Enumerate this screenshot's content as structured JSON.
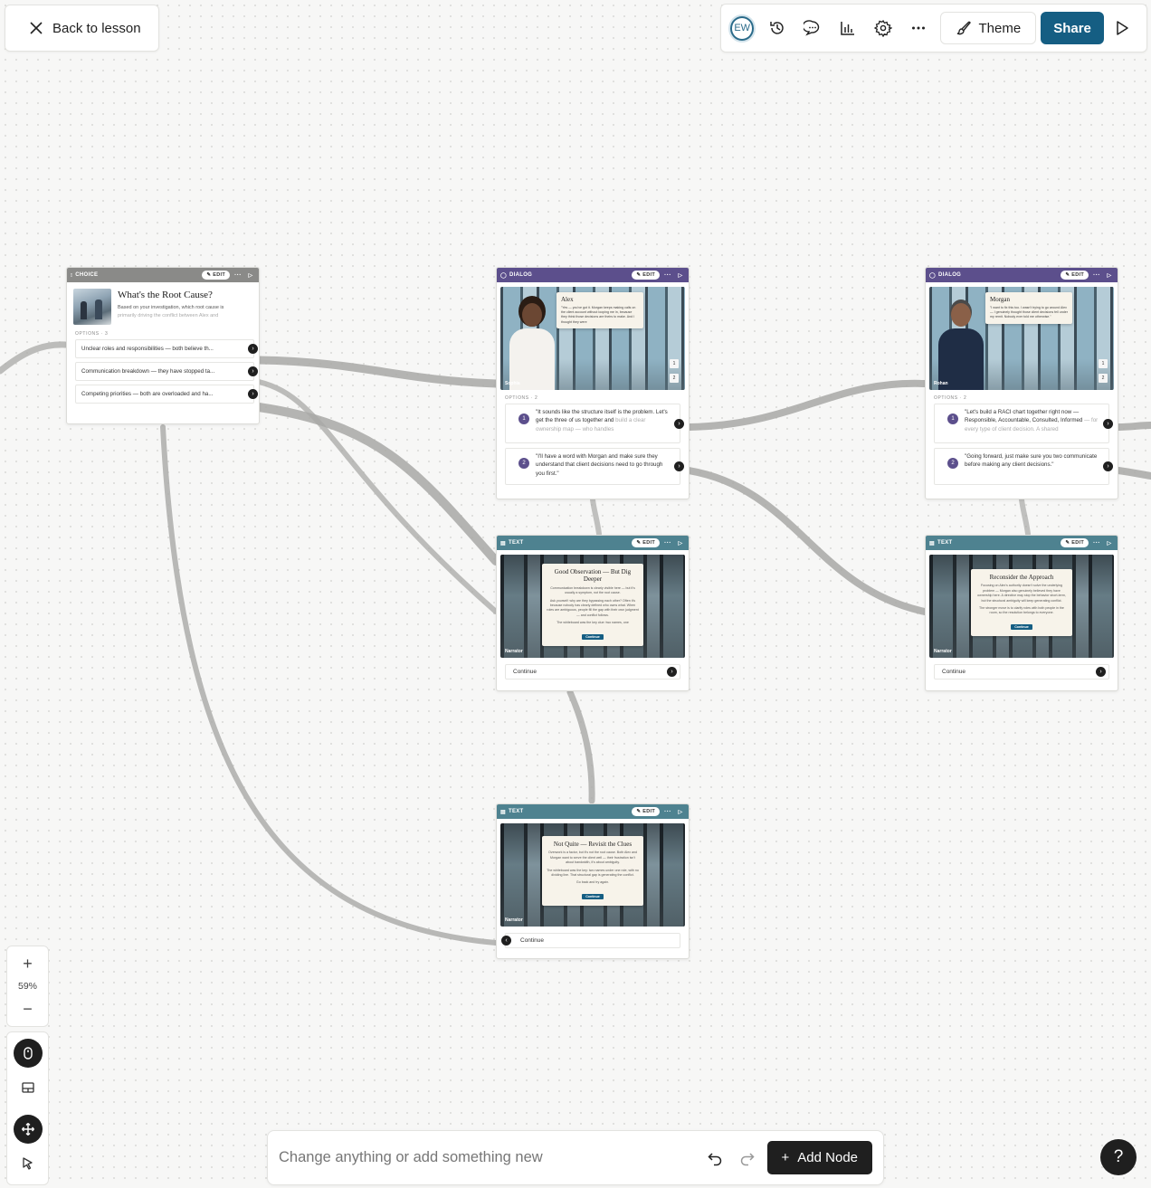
{
  "top_left": {
    "back_label": "Back to lesson"
  },
  "toolbar": {
    "avatar_initials": "EW",
    "icons": [
      "history-icon",
      "comment-icon",
      "analytics-icon",
      "settings-icon",
      "more-icon"
    ],
    "theme_label": "Theme",
    "share_label": "Share",
    "accent_color": "#155e83"
  },
  "nodes": {
    "choice": {
      "type": "CHOICE",
      "edit": "EDIT",
      "title": "What's the Root Cause?",
      "desc_1": "Based on your investigation, which root cause is",
      "desc_2": "primarily driving the conflict between Alex and",
      "options_label": "OPTIONS · 3",
      "options": [
        "Unclear roles and responsibilities — both believe th...",
        "Communication breakdown — they have stopped ta...",
        "Competing priorities — both are overloaded and ha..."
      ]
    },
    "dialog_alex": {
      "type": "DIALOG",
      "edit": "EDIT",
      "speaker": "Alex",
      "speech": "\"Yes — you've got it. Morgan keeps making calls on the client account without looping me in, because they think those decisions are theirs to make. And I thought they were",
      "name_tag": "Sophia",
      "steps": [
        "1",
        "2"
      ],
      "options_label": "OPTIONS · 2",
      "responses": [
        {
          "num": "1",
          "text": "\"It sounds like the structure itself is the problem. Let's get the three of us together and",
          "fade": "build a clear ownership map — who handles"
        },
        {
          "num": "2",
          "text": "\"I'll have a word with Morgan and make sure they understand that client decisions need to go through you first.\"",
          "fade": ""
        }
      ]
    },
    "dialog_morgan": {
      "type": "DIALOG",
      "edit": "EDIT",
      "speaker": "Morgan",
      "speech": "\"I want to fix this too. I wasn't trying to go around Alex — I genuinely thought those client decisions fell under my remit. Nobody ever told me otherwise.\"",
      "name_tag": "Rohan",
      "steps": [
        "1",
        "2"
      ],
      "options_label": "OPTIONS · 2",
      "responses": [
        {
          "num": "1",
          "text": "\"Let's build a RACI chart together right now — Responsible, Accountable, Consulted, Informed",
          "fade": "— for every type of client decision. A shared"
        },
        {
          "num": "2",
          "text": "\"Going forward, just make sure you two communicate before making any client decisions.\"",
          "fade": ""
        }
      ]
    },
    "text_good": {
      "type": "TEXT",
      "edit": "EDIT",
      "title": "Good Observation — But Dig Deeper",
      "body_1": "Communication breakdown is clearly visible here — but it's usually a symptom, not the root cause.",
      "body_2": "Ask yourself: why are they bypassing each other? Often it's because nobody has clearly defined who owns what. When roles are ambiguous, people fill the gap with their own judgment — and conflict follows.",
      "body_3": "The whiteboard was the key clue: two names, one",
      "button": "Continue",
      "name_tag": "Narrator",
      "continue_label": "Continue"
    },
    "text_reconsider": {
      "type": "TEXT",
      "edit": "EDIT",
      "title": "Reconsider the Approach",
      "body_1": "Focusing on Alex's authority doesn't solve the underlying problem — Morgan also genuinely believed they have ownership here. A directive may stop the behavior short-term, but the structural ambiguity will keep generating conflict.",
      "body_2": "The stronger move is to clarify roles with both people in the room, so the resolution belongs to everyone.",
      "button": "Continue",
      "name_tag": "Narrator",
      "continue_label": "Continue"
    },
    "text_notquite": {
      "type": "TEXT",
      "edit": "EDIT",
      "title": "Not Quite — Revisit the Clues",
      "body_1": "Overwork is a factor, but it's not the root cause. Both Alex and Morgan want to serve the client well — their frustration isn't about bandwidth, it's about ambiguity.",
      "body_2": "The whiteboard was the key: two names under one role, with no dividing line. That structural gap is generating the conflict.",
      "body_3": "Go back and try again.",
      "button": "Continue",
      "name_tag": "Narrator",
      "continue_label": "Continue"
    }
  },
  "zoom": {
    "plus": "+",
    "level": "59%",
    "minus": "−"
  },
  "prompt": {
    "placeholder": "Change anything or add something new",
    "add_node_label": "Add Node"
  },
  "help_label": "?"
}
